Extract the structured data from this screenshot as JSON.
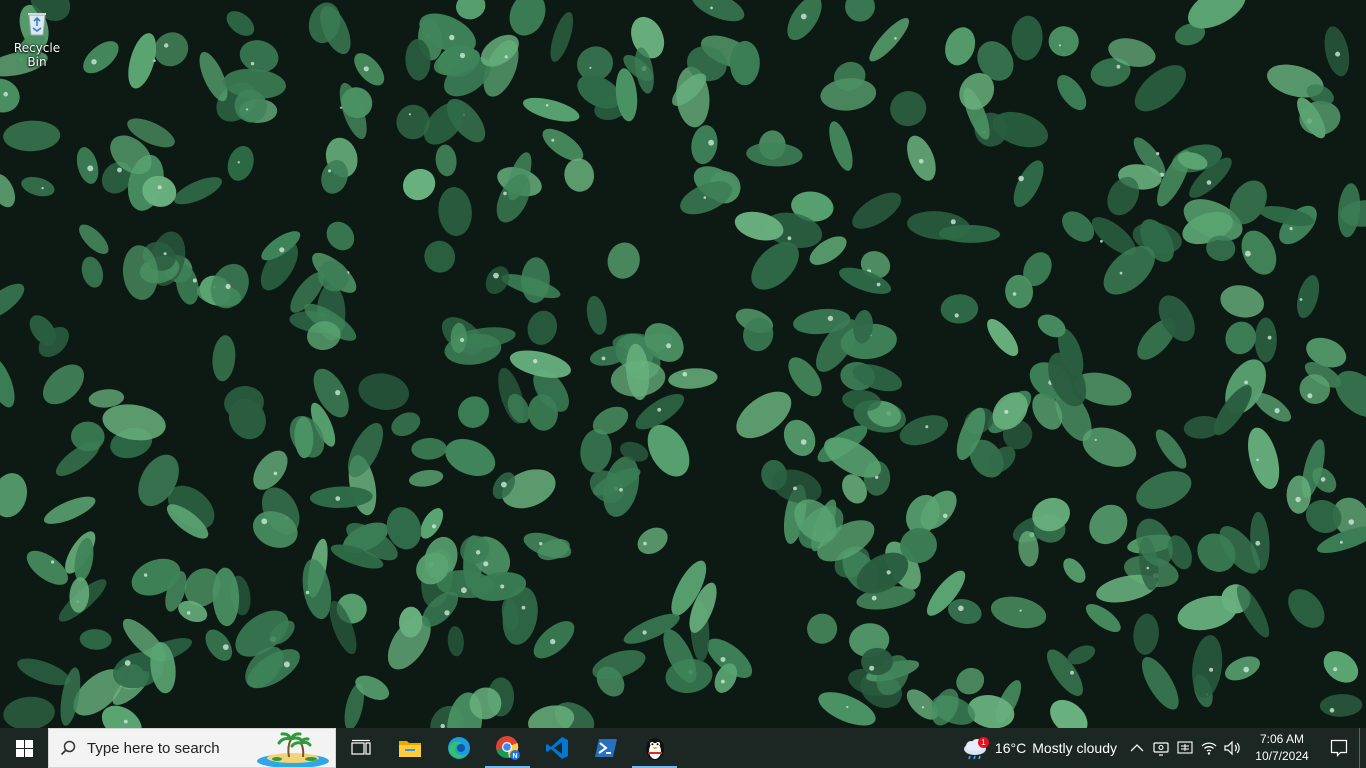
{
  "desktop": {
    "icons": [
      {
        "label": "Recycle Bin",
        "icon": "recycle-bin-icon"
      }
    ],
    "wallpaper": "green leaves with water droplets"
  },
  "taskbar": {
    "start_icon": "windows-logo-icon",
    "search": {
      "placeholder": "Type here to search",
      "highlight_icon": "tropical-island-icon"
    },
    "apps": [
      {
        "name": "Task View",
        "icon": "task-view-icon",
        "active": false
      },
      {
        "name": "File Explorer",
        "icon": "folder-icon",
        "active": false
      },
      {
        "name": "Microsoft Edge",
        "icon": "edge-icon",
        "active": false
      },
      {
        "name": "Google Chrome",
        "icon": "chrome-icon",
        "active": true
      },
      {
        "name": "Visual Studio Code",
        "icon": "vscode-icon",
        "active": false
      },
      {
        "name": "PowerShell",
        "icon": "powershell-icon",
        "active": false
      },
      {
        "name": "Penguin App",
        "icon": "penguin-icon",
        "active": true
      }
    ],
    "weather": {
      "badge": "1",
      "temperature": "16°C",
      "condition": "Mostly cloudy",
      "icon": "cloud-rain-icon"
    },
    "tray_icons": [
      "chevron-up-icon",
      "meet-now-icon",
      "ime-icon",
      "wifi-icon",
      "volume-icon"
    ],
    "clock": {
      "time": "7:06 AM",
      "date": "10/7/2024"
    },
    "notification_icon": "notification-icon",
    "colors": {
      "taskbar": "#1c2723",
      "accent": "#76b9ed"
    }
  }
}
